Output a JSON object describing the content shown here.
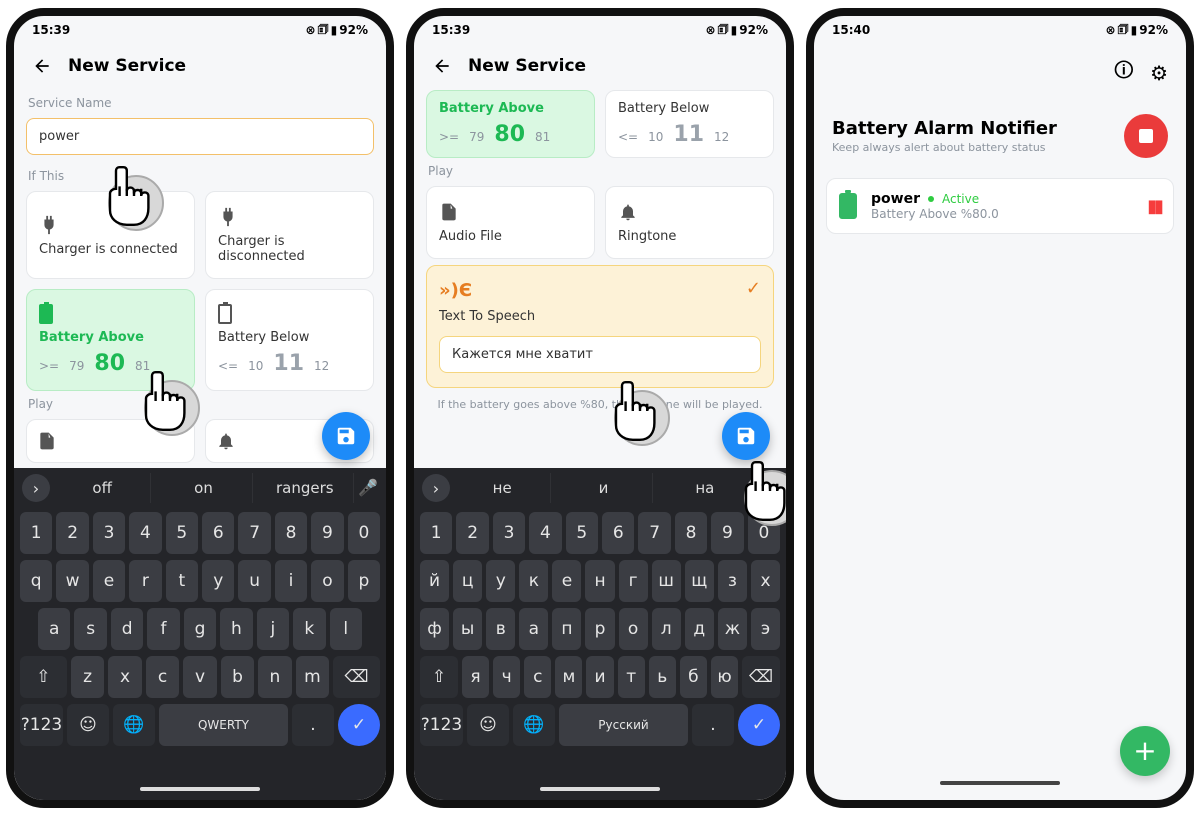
{
  "status": {
    "time1": "15:39",
    "time2": "15:39",
    "time3": "15:40",
    "battery": "92%"
  },
  "phone1": {
    "header": "New Service",
    "section_service": "Service Name",
    "input_value": "power",
    "section_if": "If This",
    "cards": {
      "ch_conn": "Charger is connected",
      "ch_disc": "Charger is disconnected",
      "bat_above": "Battery Above",
      "bat_below": "Battery Below"
    },
    "above": {
      "op": ">=",
      "prev": "79",
      "main": "80",
      "next": "81"
    },
    "below": {
      "op": "<=",
      "prev": "10",
      "main": "11",
      "next": "12"
    },
    "section_play": "Play",
    "suggestions": [
      "off",
      "on",
      "rangers"
    ],
    "kb_rows": {
      "r1": [
        "1",
        "2",
        "3",
        "4",
        "5",
        "6",
        "7",
        "8",
        "9",
        "0"
      ],
      "r2": [
        "q",
        "w",
        "e",
        "r",
        "t",
        "y",
        "u",
        "i",
        "o",
        "p"
      ],
      "r3": [
        "a",
        "s",
        "d",
        "f",
        "g",
        "h",
        "j",
        "k",
        "l"
      ],
      "r4": [
        "z",
        "x",
        "c",
        "v",
        "b",
        "n",
        "m"
      ]
    },
    "kb_symbols": "?123",
    "kb_space": "QWERTY"
  },
  "phone2": {
    "header": "New Service",
    "cards": {
      "bat_above": "Battery Above",
      "bat_below": "Battery Below",
      "audio": "Audio File",
      "ringtone": "Ringtone"
    },
    "above": {
      "op": ">=",
      "prev": "79",
      "main": "80",
      "next": "81"
    },
    "below": {
      "op": "<=",
      "prev": "10",
      "main": "11",
      "next": "12"
    },
    "section_play": "Play",
    "tts_title": "Text To Speech",
    "tts_input": "Кажется мне хватит",
    "hint": "If the battery goes above %80, the ringtone will be played.",
    "suggestions": [
      "не",
      "и",
      "на"
    ],
    "kb_rows": {
      "r1": [
        "1",
        "2",
        "3",
        "4",
        "5",
        "6",
        "7",
        "8",
        "9",
        "0"
      ],
      "r2": [
        "й",
        "ц",
        "у",
        "к",
        "е",
        "н",
        "г",
        "ш",
        "щ",
        "з",
        "х"
      ],
      "r3": [
        "ф",
        "ы",
        "в",
        "а",
        "п",
        "р",
        "о",
        "л",
        "д",
        "ж",
        "э"
      ],
      "r4": [
        "я",
        "ч",
        "с",
        "м",
        "и",
        "т",
        "ь",
        "б",
        "ю"
      ]
    },
    "kb_symbols": "?123",
    "kb_space": "Русский"
  },
  "phone3": {
    "title": "Battery Alarm Notifier",
    "subtitle": "Keep always alert about battery status",
    "service_name": "power",
    "active": "Active",
    "service_line": "Battery Above %80.0"
  }
}
